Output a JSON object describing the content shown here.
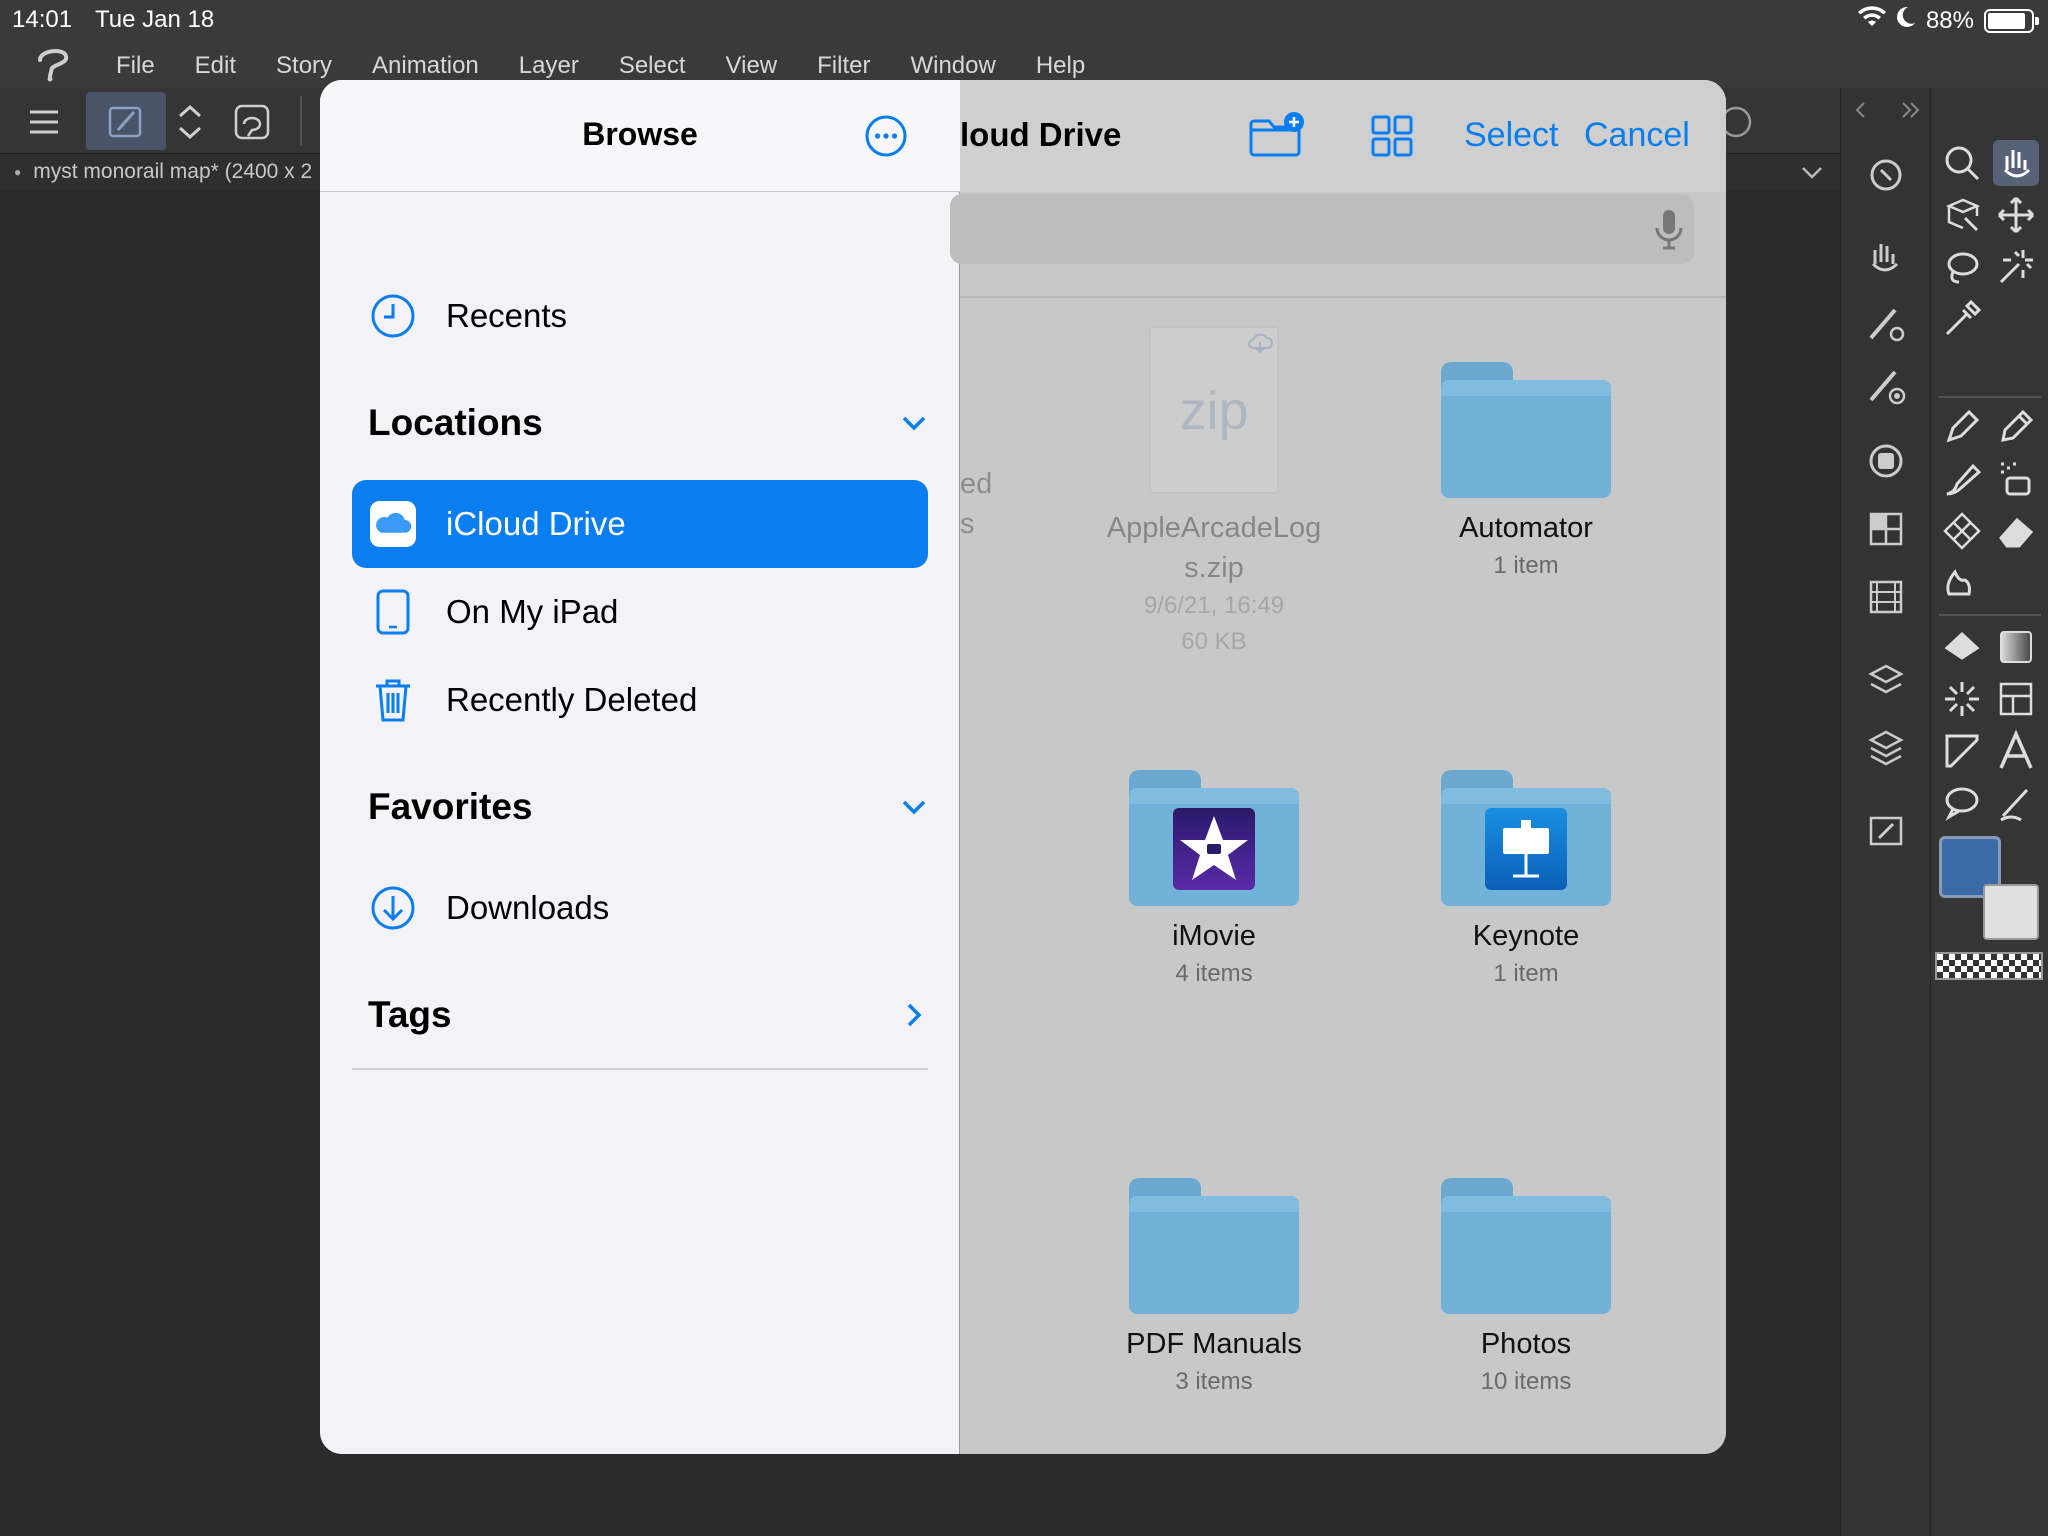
{
  "status_bar": {
    "time": "14:01",
    "date": "Tue Jan 18",
    "battery": "88%",
    "battery_level": 0.88
  },
  "menu": {
    "items": [
      "File",
      "Edit",
      "Story",
      "Animation",
      "Layer",
      "Select",
      "View",
      "Filter",
      "Window",
      "Help"
    ]
  },
  "document": {
    "tab_title": "myst monorail map* (2400 x 2"
  },
  "picker": {
    "sidebar": {
      "title": "Browse",
      "recents": "Recents",
      "locations": {
        "header": "Locations",
        "items": [
          "iCloud Drive",
          "On My iPad",
          "Recently Deleted"
        ]
      },
      "favorites": {
        "header": "Favorites",
        "items": [
          "Downloads"
        ]
      },
      "tags": {
        "header": "Tags"
      }
    },
    "main": {
      "title": "loud Drive",
      "select_label": "Select",
      "cancel_label": "Cancel",
      "partial_item": {
        "line1": "ed",
        "line2": "s"
      },
      "items": [
        {
          "name_line1": "AppleArcadeLog",
          "name_line2": "s.zip",
          "date": "9/6/21, 16:49",
          "size": "60 KB",
          "type": "zip",
          "type_label": "zip"
        },
        {
          "name": "Automator",
          "sub": "1 item"
        },
        {
          "name": "iMovie",
          "sub": "4 items"
        },
        {
          "name": "Keynote",
          "sub": "1 item"
        },
        {
          "name": "PDF Manuals",
          "sub": "3 items"
        },
        {
          "name": "Photos",
          "sub": "10 items"
        }
      ]
    }
  },
  "colors": {
    "accent": "#0a7ef0",
    "folder": "#72b2d9",
    "foreground_color": "#3b6aa8"
  }
}
